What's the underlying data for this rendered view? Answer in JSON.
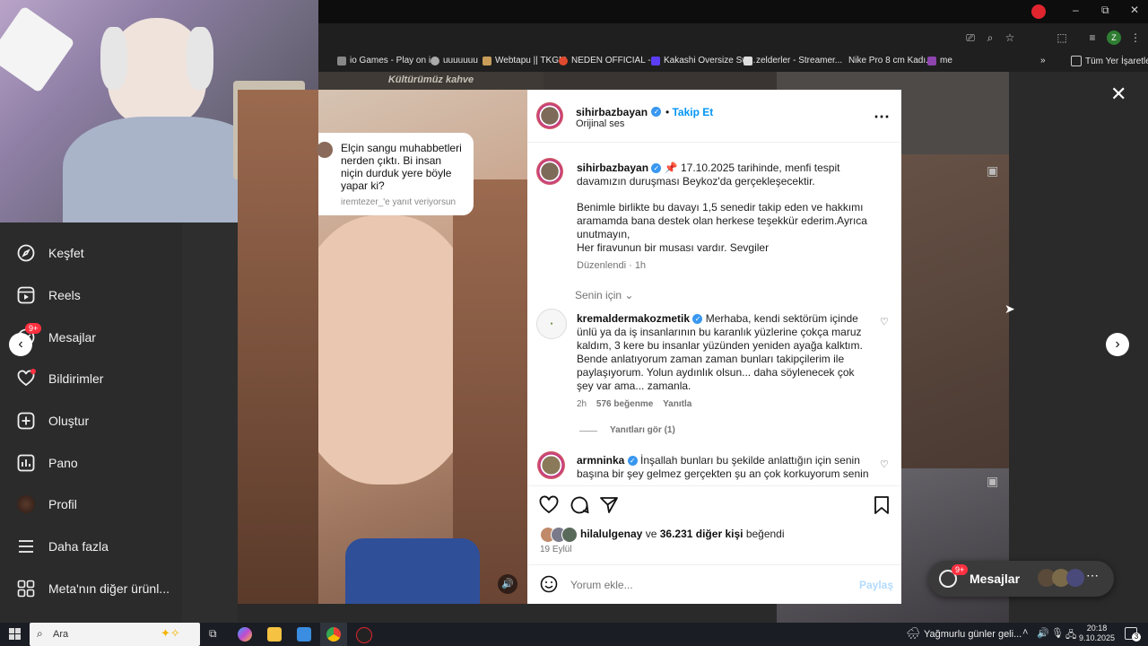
{
  "browser": {
    "bookmarks": [
      {
        "label": "io Games - Play on i..."
      },
      {
        "label": "uuuuuuu"
      },
      {
        "label": "Webtapu || TKGM"
      },
      {
        "label": "NEDEN OFFICIAL -..."
      },
      {
        "label": "Kakashi Oversize Sw..."
      },
      {
        "label": "zelderler - Streamer..."
      },
      {
        "label": "Nike Pro 8 cm Kadı..."
      },
      {
        "label": "me"
      }
    ],
    "all_bookmarks_label": "Tüm Yer İşaretleri",
    "profile_initial": "Z"
  },
  "nav": {
    "items": [
      {
        "label": "Keşfet",
        "icon": "compass-icon"
      },
      {
        "label": "Reels",
        "icon": "reels-icon"
      },
      {
        "label": "Mesajlar",
        "icon": "messenger-icon",
        "badge": "9+"
      },
      {
        "label": "Bildirimler",
        "icon": "heart-icon"
      },
      {
        "label": "Oluştur",
        "icon": "plus-square-icon"
      },
      {
        "label": "Pano",
        "icon": "dashboard-icon"
      },
      {
        "label": "Profil",
        "icon": "avatar-icon"
      },
      {
        "label": "Daha fazla",
        "icon": "menu-icon"
      },
      {
        "label": "Meta'nın diğer ürünl...",
        "icon": "apps-icon"
      }
    ]
  },
  "background_text": "Kültürümüz kahve",
  "chat_popup": {
    "message": "Elçin sangu muhabbetleri nerden çıktı. Bi insan niçin durduk yere böyle yapar ki?",
    "reply_note": "iremtezer_'e yanıt veriyorsun"
  },
  "post": {
    "author": "sihirbazbayan",
    "follow_label": "Takip Et",
    "audio_label": "Orijinal ses",
    "caption": {
      "author": "sihirbazbayan",
      "line1": "📌 17.10.2025 tarihinde, menfi tespit davamızın duruşması Beykoz'da gerçekleşecektir.",
      "line2": "Benimle birlikte bu davayı 1,5 senedir takip eden ve hakkımı aramamda bana destek olan herkese teşekkür ederim.Ayrıca unutmayın,",
      "line3": "Her firavunun bir musası vardır. Sevgiler",
      "meta": "Düzenlendi · 1h"
    },
    "sort_label": "Senin için",
    "comments": [
      {
        "author": "kremaldermakozmetik",
        "text": "Merhaba, kendi sektörüm içinde ünlü ya da iş insanlarının bu karanlık yüzlerine çokça maruz kaldım, 3 kere bu insanlar yüzünden yeniden ayağa kalktım. Bende anlatıyorum zaman zaman bunları takipçilerim ile paylaşıyorum. Yolun aydınlık olsun... daha söylenecek çok şey var ama... zamanla.",
        "time": "2h",
        "likes": "576 beğenme",
        "reply_label": "Yanıtla",
        "view_replies": "Yanıtları gör (1)"
      },
      {
        "author": "armninka",
        "text": "İnşallah bunları bu şekilde anlattığın için senin başına bir şey gelmez gerçekten şu an çok korkuyorum senin"
      }
    ],
    "likes_user": "hilalulgenay",
    "likes_and": "ve",
    "likes_count": "36.231 diğer kişi",
    "likes_suffix": "beğendi",
    "date": "19 Eylül",
    "comment_placeholder": "Yorum ekle...",
    "share_label": "Paylaş"
  },
  "messages_button": {
    "label": "Mesajlar",
    "badge": "9+"
  },
  "taskbar": {
    "search_label": "Ara",
    "weather": "Yağmurlu günler geli...",
    "time": "20:18",
    "date": "9.10.2025",
    "notif_count": "3"
  },
  "colors": {
    "accent": "#0095f6",
    "like_blue": "#3897f0",
    "badge": "#ff3040"
  }
}
